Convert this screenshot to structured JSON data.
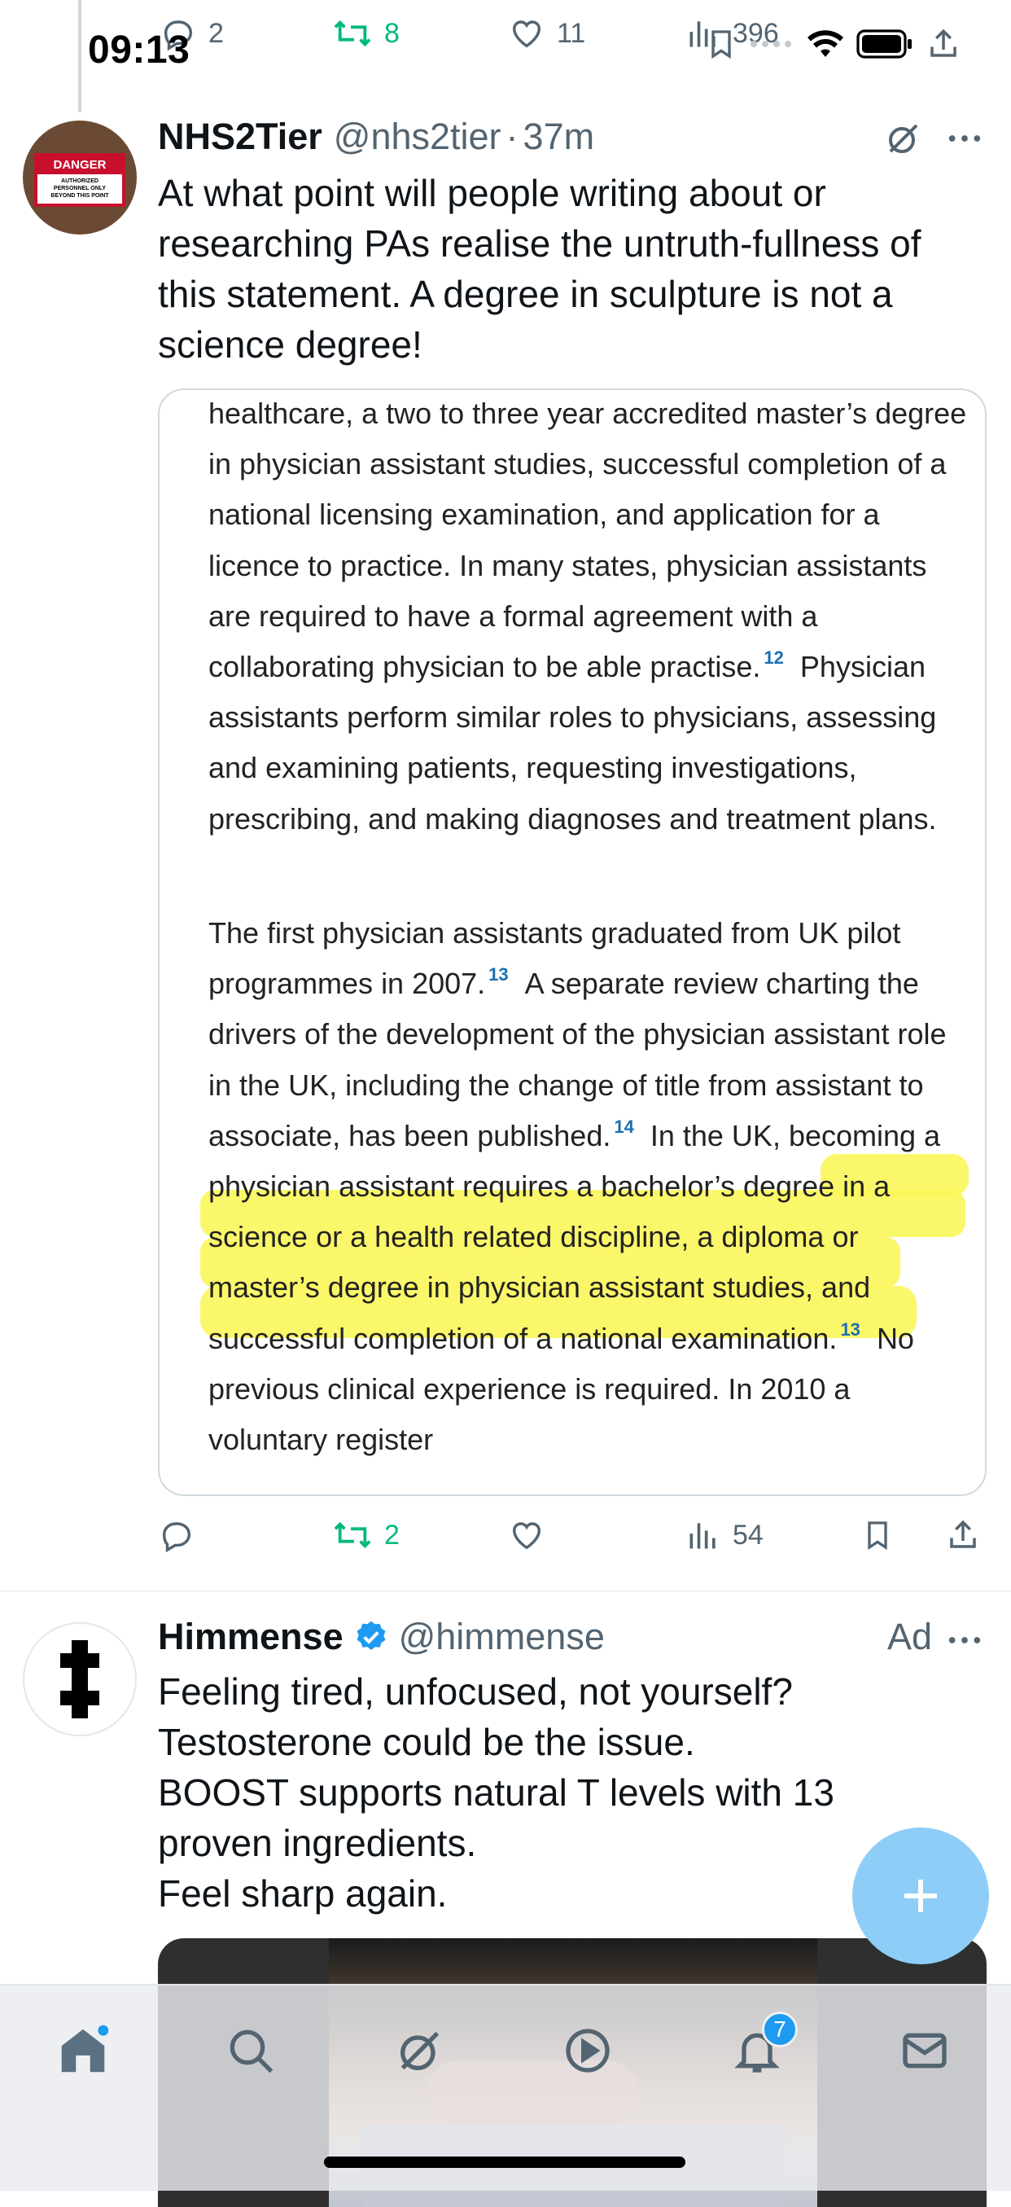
{
  "status_bar": {
    "time": "09:13"
  },
  "prev_tweet_actions": {
    "replies": "2",
    "reposts": "8",
    "likes": "11",
    "views": "396"
  },
  "tweet": {
    "author_name": "NHS2Tier",
    "handle": "@nhs2tier",
    "separator": "·",
    "age": "37m",
    "avatar_sign": {
      "top": "DANGER",
      "text": "AUTHORIZED PERSONNEL ONLY BEYOND THIS POINT"
    },
    "text": "At what point will people writing about or researching PAs realise the untruth-fullness of this statement. A degree in sculpture is not a science degree!",
    "image_text": {
      "p1": "healthcare, a two to three year accredited master’s degree in physician assistant studies, successful completion of a national licensing examination, and application for a licence to practice. In many states, physician assistants are required to have a formal agreement with a collaborating physician to be able practise.",
      "p1_ref": "12",
      "p1_tail": "Physician assistants perform similar roles to physicians, assessing and examining patients, requesting investigations, prescribing, and making diagnoses and treatment plans.",
      "p2_a": "The first physician assistants graduated from UK pilot programmes in 2007.",
      "p2_ref1": "13",
      "p2_b": "A separate review charting the drivers of the development of the physician assistant role in the UK, including the change of title from assistant to associate, has been published.",
      "p2_ref2": "14",
      "p2_c": "In the UK, becoming a physician assistant requires a bachelor’s degree in a science or a health related discipline, a diploma or master’s degree in physician assistant studies, and successful completion of a national examination.",
      "p2_ref3": "13",
      "p2_d": "No previous clinical experience is required. In 2010 a voluntary register"
    },
    "reposts": "2",
    "views": "54",
    "highlight_color": "#fbf65a"
  },
  "ad_tweet": {
    "author_name": "Himmense",
    "handle": "@himmense",
    "ad_label": "Ad",
    "text": "Feeling tired, unfocused, not yourself?\nTestosterone could be the issue.\nBOOST supports natural T levels with 13 proven ingredients.\nFeel sharp again."
  },
  "tab_bar": {
    "notifications_badge": "7"
  },
  "colors": {
    "accent": "#1d9bf0",
    "repost": "#00ba7c",
    "fab": "#8ecdf7"
  }
}
